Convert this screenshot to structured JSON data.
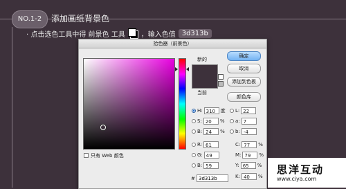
{
  "header": {
    "step": "NO.1-2",
    "title": "添加画纸背景色"
  },
  "instruction": {
    "part1": "· 点击选色工具中得 前景色 工具",
    "part2": "，输入色值",
    "value": "3d313b",
    "icon": "foreground-background-color-icon"
  },
  "dialog": {
    "title": "拾色器（前景色）",
    "new_label": "新的",
    "current_label": "当前",
    "current_color": "#3d313b",
    "buttons": {
      "ok": "确定",
      "cancel": "取消",
      "add_swatch": "添加到色板",
      "color_libraries": "颜色库"
    },
    "web_only": "只有 Web 颜色",
    "fields": {
      "H": {
        "label": "H:",
        "value": "310",
        "unit": "度"
      },
      "S": {
        "label": "S:",
        "value": "20",
        "unit": "%"
      },
      "B": {
        "label": "B:",
        "value": "24",
        "unit": "%"
      },
      "R": {
        "label": "R:",
        "value": "61"
      },
      "G": {
        "label": "G:",
        "value": "49"
      },
      "Bl": {
        "label": "B:",
        "value": "59"
      },
      "L": {
        "label": "L:",
        "value": "22"
      },
      "a": {
        "label": "a:",
        "value": "7"
      },
      "b": {
        "label": "b:",
        "value": "-4"
      },
      "C": {
        "label": "C:",
        "value": "77",
        "unit": "%"
      },
      "M": {
        "label": "M:",
        "value": "79",
        "unit": "%"
      },
      "Y": {
        "label": "Y:",
        "value": "65",
        "unit": "%"
      },
      "K": {
        "label": "K:",
        "value": "40",
        "unit": "%"
      }
    },
    "hex_prefix": "#",
    "hex_value": "3d313b"
  },
  "watermark": {
    "name": "思洋互动",
    "url": "www.ciya.com"
  }
}
